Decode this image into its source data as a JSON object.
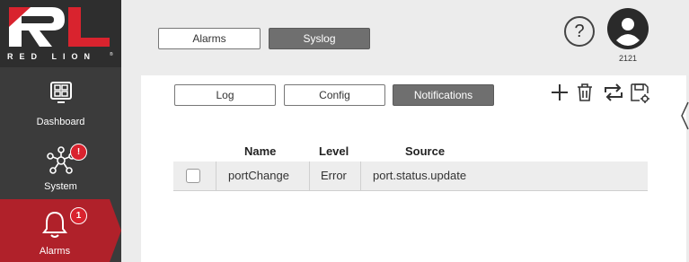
{
  "brand": {
    "logo_letters": "RL",
    "name": "RED LION",
    "reg": "®"
  },
  "sidebar": {
    "items": [
      {
        "label": "Dashboard"
      },
      {
        "label": "System",
        "badge": "!"
      },
      {
        "label": "Alarms",
        "badge": "1"
      }
    ],
    "active": "Alarms"
  },
  "top_tabs": {
    "alarms": "Alarms",
    "syslog": "Syslog"
  },
  "sub_tabs": {
    "log": "Log",
    "config": "Config",
    "notifications": "Notifications"
  },
  "header": {
    "help_symbol": "?",
    "user_id": "2121"
  },
  "toolbar": {
    "icons": [
      "plus-icon",
      "trash-icon",
      "repeat-icon",
      "save-config-icon"
    ]
  },
  "table": {
    "headers": {
      "name": "Name",
      "level": "Level",
      "source": "Source"
    },
    "rows": [
      {
        "checked": false,
        "name": "portChange",
        "level": "Error",
        "source": "port.status.update"
      }
    ]
  },
  "colors": {
    "sidebar": "#3b3b3b",
    "active": "#b0212a",
    "badge": "#d9232e",
    "selected_tab": "#6f6f6f"
  }
}
